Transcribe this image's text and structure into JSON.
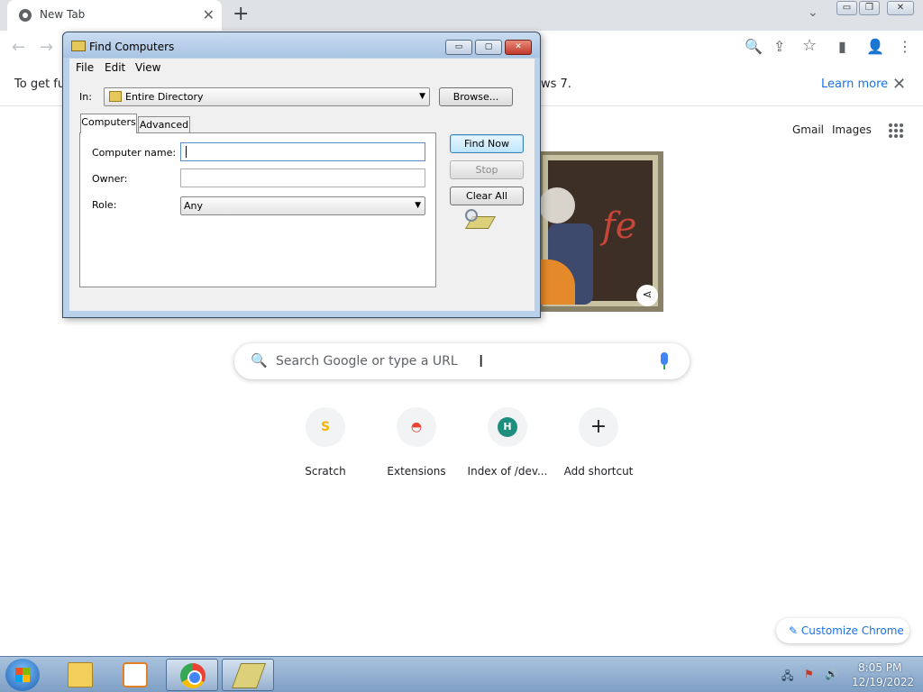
{
  "browser": {
    "tab_title": "New Tab",
    "tab_close": "✕",
    "new_tab": "+",
    "tab_search": "⌄",
    "win_minimize": "▭",
    "win_restore": "❐",
    "win_close": "✕",
    "back": "←",
    "forward": "→",
    "zoom_icon": "🔍",
    "share_icon": "⇪",
    "star_icon": "☆",
    "sidepanel_icon": "▮",
    "profile_icon": "👤",
    "menu_icon": "⋮",
    "infobar_text_left": "To get fut",
    "infobar_text_right": "ws 7.",
    "infobar_learn_more": "Learn more",
    "infobar_close": "✕"
  },
  "ntp": {
    "gmail": "Gmail",
    "images": "Images",
    "search_placeholder": "Search Google or type a URL",
    "search_icon": "🔍",
    "cursor": "I",
    "doodle_text": "fe",
    "doodle_share": "⋖",
    "shortcuts": [
      {
        "label": "Scratch",
        "icon": "S",
        "color": "#f4b400"
      },
      {
        "label": "Extensions",
        "icon": "◓",
        "color": "#ea4335"
      },
      {
        "label": "Index of /dev...",
        "icon": "H",
        "color": "#1e8e7e"
      },
      {
        "label": "Add shortcut",
        "icon": "+",
        "color": "#202124"
      }
    ],
    "customize_icon": "✎",
    "customize_label": "Customize Chrome"
  },
  "dialog": {
    "title": "Find Computers",
    "minimize": "▭",
    "maximize": "▢",
    "close": "✕",
    "menu": [
      "File",
      "Edit",
      "View"
    ],
    "in_label": "In:",
    "in_value": "Entire Directory",
    "browse": "Browse...",
    "tabs": [
      "Computers",
      "Advanced"
    ],
    "computer_name_label": "Computer name:",
    "computer_name_value": "",
    "owner_label": "Owner:",
    "owner_value": "",
    "role_label": "Role:",
    "role_value": "Any",
    "find_now": "Find Now",
    "stop": "Stop",
    "clear_all": "Clear All",
    "dropdown_arrow": "▼"
  },
  "taskbar": {
    "time": "8:05 PM",
    "date": "12/19/2022",
    "tray_network": "🖧",
    "tray_flag": "⚑",
    "tray_volume": "🔊"
  }
}
